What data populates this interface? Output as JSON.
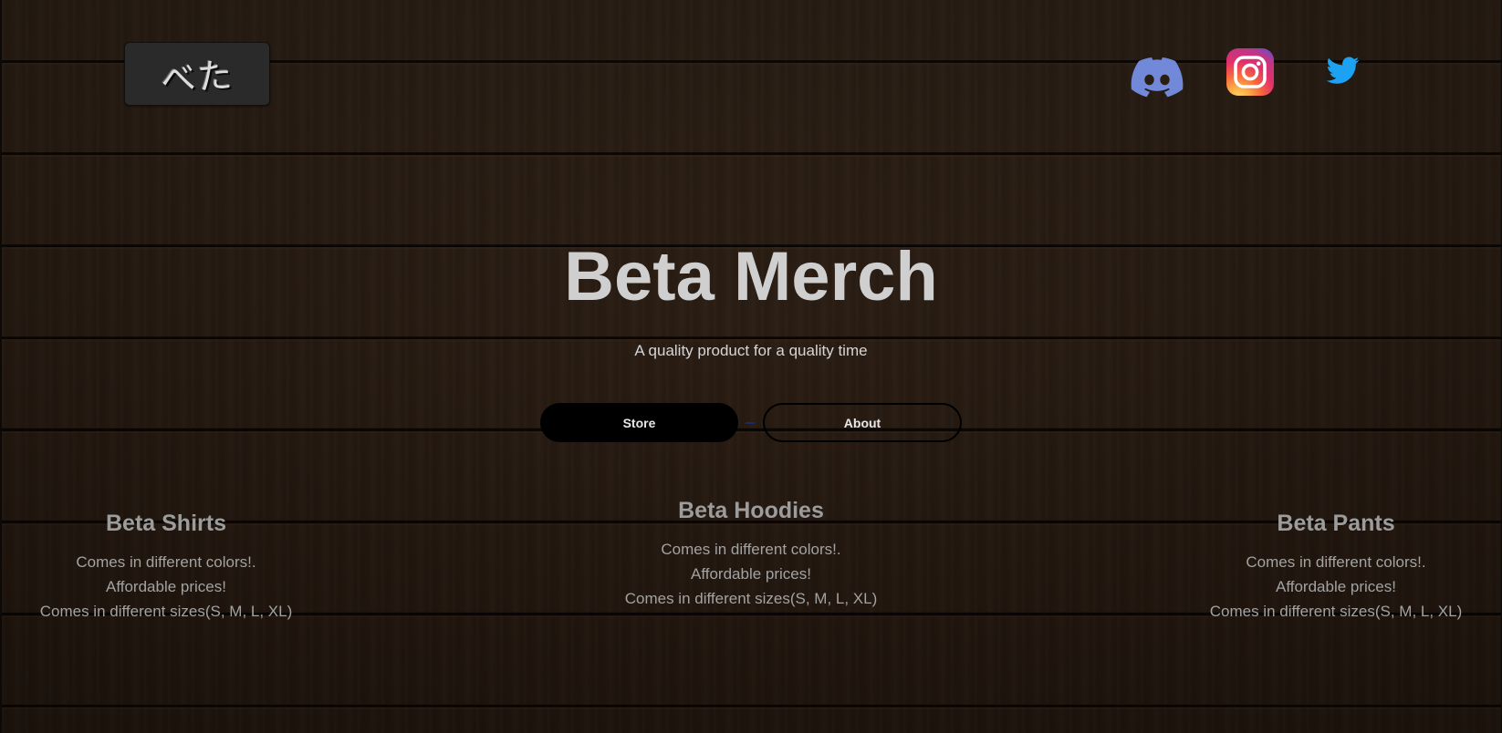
{
  "header": {
    "logo_text": "べた",
    "social_links": [
      {
        "name": "Discord",
        "icon": "discord-icon",
        "color": "#7289da"
      },
      {
        "name": "Instagram",
        "icon": "instagram-icon",
        "color": "#e1306c"
      },
      {
        "name": "Twitter",
        "icon": "twitter-icon",
        "color": "#1da1f2"
      }
    ]
  },
  "hero": {
    "title": "Beta Merch",
    "subtitle": "A quality product for a quality time",
    "store_label": "Store",
    "about_label": "About"
  },
  "features": [
    {
      "title": "Beta Shirts",
      "lines": [
        "Comes in different colors!.",
        "Affordable prices!",
        "Comes in different sizes(S, M, L, XL)"
      ]
    },
    {
      "title": "Beta Hoodies",
      "lines": [
        "Comes in different colors!.",
        "Affordable prices!",
        "Comes in different sizes(S, M, L, XL)"
      ]
    },
    {
      "title": "Beta Pants",
      "lines": [
        "Comes in different colors!.",
        "Affordable prices!",
        "Comes in different sizes(S, M, L, XL)"
      ]
    }
  ],
  "colors": {
    "background_wood": "#2c1f15",
    "title_text": "#cfcfcf",
    "feature_text": "#a2a2a2",
    "button_fill": "#000000"
  }
}
